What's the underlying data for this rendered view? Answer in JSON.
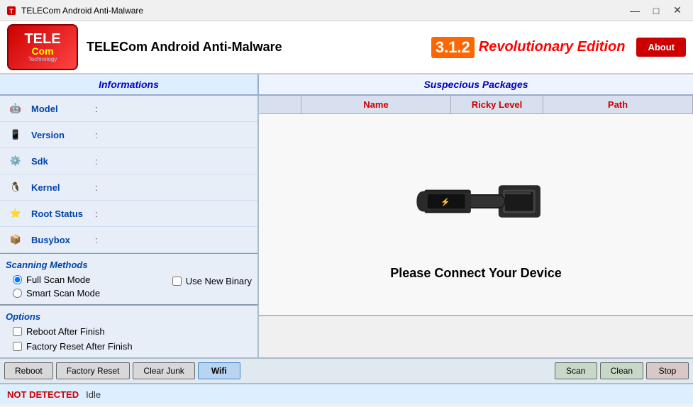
{
  "titlebar": {
    "title": "TELECom Android Anti-Malware",
    "minimize": "—",
    "maximize": "□",
    "close": "✕"
  },
  "header": {
    "logo_tele": "TELE",
    "logo_com": "Com",
    "logo_tech": "Technology",
    "app_name": "TELECom Android Anti-Malware",
    "version": "3.1.2",
    "subtitle": "Revolutionary Edition",
    "about_label": "About"
  },
  "tabs": {
    "info_label": "Informations",
    "suspicious_label": "Suspecious Packages"
  },
  "info_fields": [
    {
      "icon": "🤖",
      "label": "Model",
      "value": ""
    },
    {
      "icon": "📱",
      "label": "Version",
      "value": ""
    },
    {
      "icon": "⚙️",
      "label": "Sdk",
      "value": ""
    },
    {
      "icon": "🐧",
      "label": "Kernel",
      "value": ""
    },
    {
      "icon": "⭐",
      "label": "Root Status",
      "value": ""
    },
    {
      "icon": "📦",
      "label": "Busybox",
      "value": ""
    }
  ],
  "scanning": {
    "title": "Scanning Methods",
    "full_scan_label": "Full Scan Mode",
    "smart_scan_label": "Smart Scan Mode",
    "use_new_binary_label": "Use New Binary"
  },
  "options": {
    "title": "Options",
    "reboot_after_label": "Reboot After Finish",
    "factory_reset_label": "Factory Reset After Finish"
  },
  "table_headers": {
    "col0": "",
    "name": "Name",
    "ricky": "Ricky Level",
    "path": "Path"
  },
  "device_message": "Please Connect Your Device",
  "buttons": {
    "reboot": "Reboot",
    "factory_reset": "Factory Reset",
    "clear_junk": "Clear Junk",
    "wifi": "Wifi",
    "scan": "Scan",
    "clean": "Clean",
    "stop": "Stop"
  },
  "status": {
    "not_detected": "NOT DETECTED",
    "idle": "Idle"
  }
}
